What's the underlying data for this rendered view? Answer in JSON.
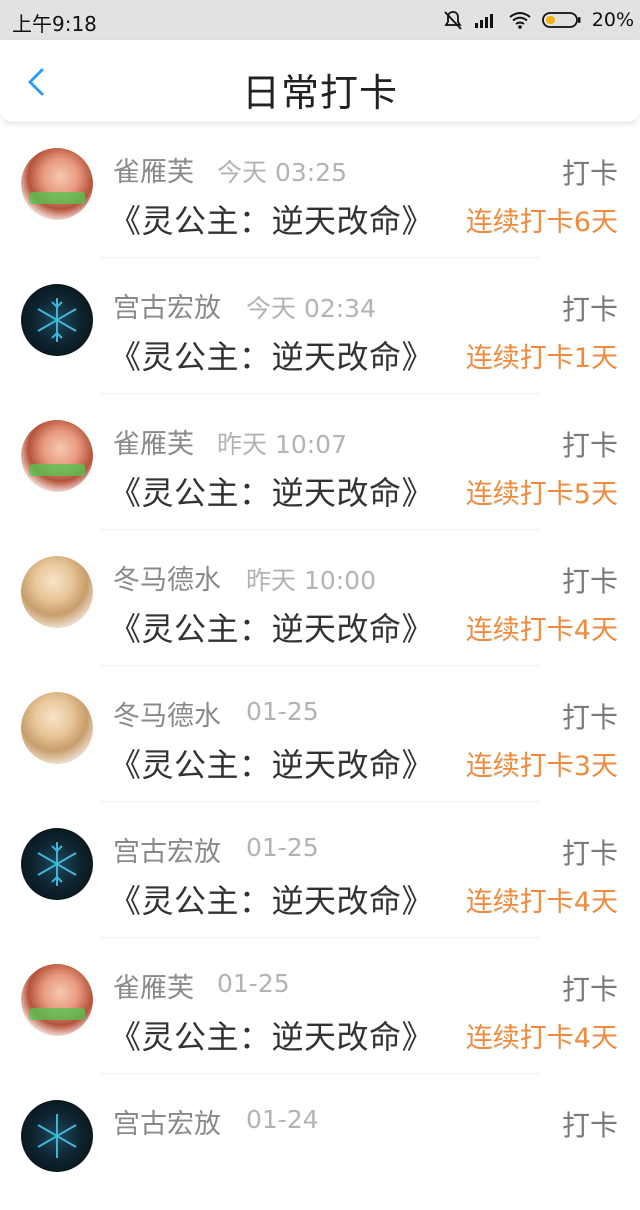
{
  "status_bar": {
    "time": "上午9:18",
    "battery": "20%"
  },
  "header": {
    "title": "日常打卡"
  },
  "entries": [
    {
      "name": "雀雁芙",
      "time": "今天 03:25",
      "book": "《灵公主：逆天改命》",
      "action": "打卡",
      "streak": "连续打卡6天"
    },
    {
      "name": "宫古宏放",
      "time": "今天 02:34",
      "book": "《灵公主：逆天改命》",
      "action": "打卡",
      "streak": "连续打卡1天"
    },
    {
      "name": "雀雁芙",
      "time": "昨天 10:07",
      "book": "《灵公主：逆天改命》",
      "action": "打卡",
      "streak": "连续打卡5天"
    },
    {
      "name": "冬马德水",
      "time": "昨天 10:00",
      "book": "《灵公主：逆天改命》",
      "action": "打卡",
      "streak": "连续打卡4天"
    },
    {
      "name": "冬马德水",
      "time": "01-25",
      "book": "《灵公主：逆天改命》",
      "action": "打卡",
      "streak": "连续打卡3天"
    },
    {
      "name": "宫古宏放",
      "time": "01-25",
      "book": "《灵公主：逆天改命》",
      "action": "打卡",
      "streak": "连续打卡4天"
    },
    {
      "name": "雀雁芙",
      "time": "01-25",
      "book": "《灵公主：逆天改命》",
      "action": "打卡",
      "streak": "连续打卡4天"
    },
    {
      "name": "宫古宏放",
      "time": "01-24",
      "book": "",
      "action": "打卡",
      "streak": ""
    }
  ],
  "colors": {
    "accent_blue": "#2a9df4",
    "streak_orange": "#f08a3c",
    "name_gray": "#8a8a8a",
    "time_gray": "#b3b3b3"
  }
}
